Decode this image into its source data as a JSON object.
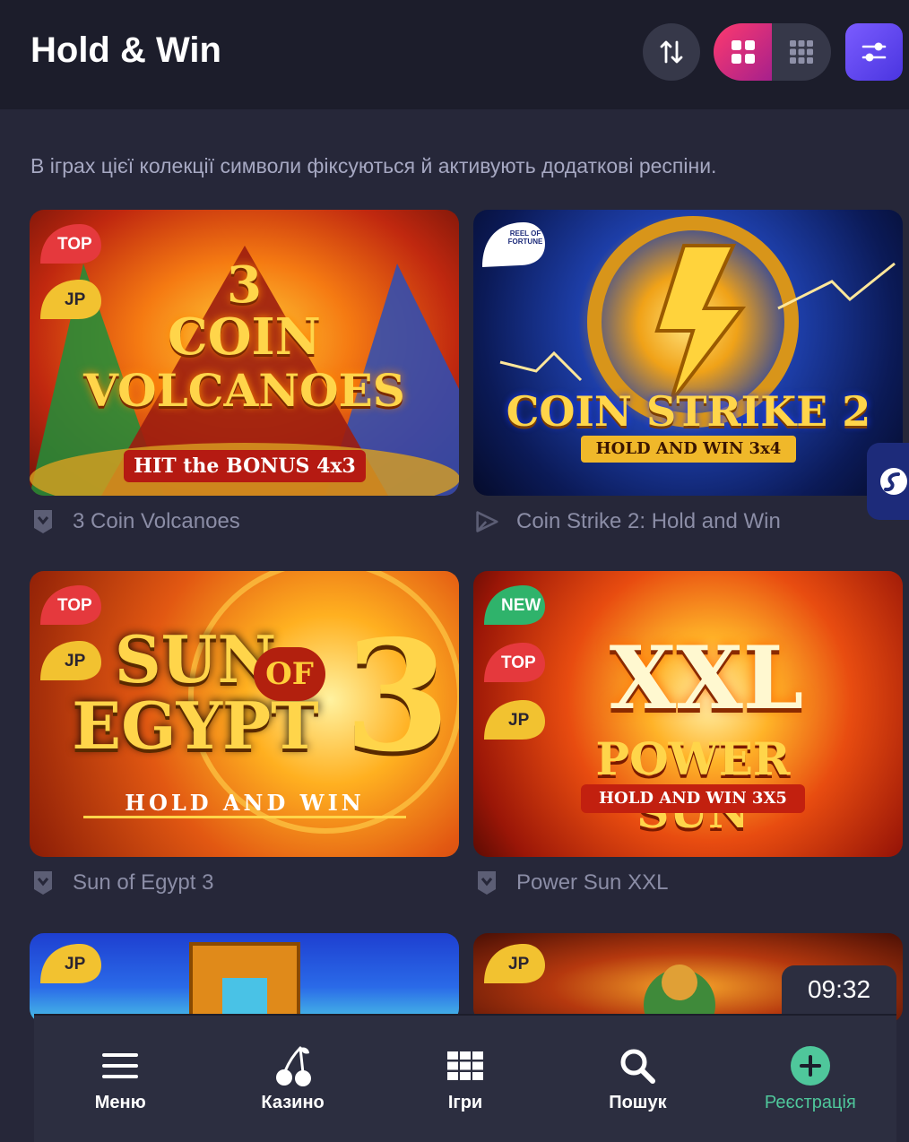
{
  "header": {
    "title": "Hold & Win"
  },
  "description": "В іграх цієї колекції символи фіксуються й активують додаткові респіни.",
  "games": [
    {
      "name": "3 Coin Volcanoes",
      "badges": [
        "TOP",
        "JP"
      ],
      "art_title": "3\nCOIN\nVOLCANOES",
      "art_sub": "HIT the BONUS 4x3",
      "provider_icon": "shield-icon"
    },
    {
      "name": "Coin Strike 2: Hold and Win",
      "badges": [],
      "ribbon": "REEL OF FORTUNE",
      "art_title": "COIN STRIKE 2",
      "art_sub": "HOLD AND WIN 3x4",
      "provider_icon": "play-arrow-icon"
    },
    {
      "name": "Sun of Egypt 3",
      "badges": [
        "TOP",
        "JP"
      ],
      "art_title": "SUN OF EGYPT 3",
      "art_sub": "HOLD AND WIN",
      "provider_icon": "shield-icon"
    },
    {
      "name": "Power Sun XXL",
      "badges": [
        "NEW",
        "TOP",
        "JP"
      ],
      "art_title": "XXL POWER SUN",
      "art_sub": "HOLD AND WIN 3X5",
      "provider_icon": "shield-icon"
    },
    {
      "badges": [
        "JP"
      ]
    },
    {
      "badges": [
        "JP"
      ]
    }
  ],
  "clock": "09:32",
  "nav": [
    {
      "label": "Меню",
      "icon": "menu-icon"
    },
    {
      "label": "Казино",
      "icon": "cherries-icon"
    },
    {
      "label": "Ігри",
      "icon": "grid-icon"
    },
    {
      "label": "Пошук",
      "icon": "search-icon"
    },
    {
      "label": "Реєстрація",
      "icon": "plus-circle-icon"
    }
  ],
  "colors": {
    "background": "#262739",
    "header": "#1c1d2b",
    "accent_pink": "#ff3a6e",
    "accent_purple": "#6b4cf5",
    "accent_green": "#4fc79b",
    "badge_top": "#e5393d",
    "badge_jp": "#f2c230",
    "badge_new": "#2fb36b"
  }
}
